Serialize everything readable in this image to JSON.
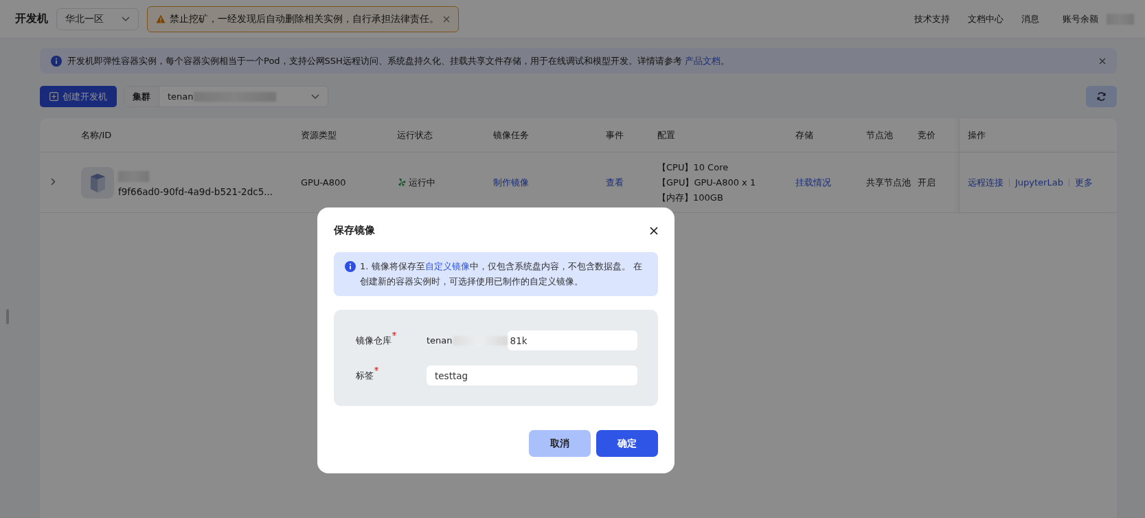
{
  "topbar": {
    "title": "开发机",
    "region": "华北一区",
    "warning": "禁止挖矿，一经发现后自动删除相关实例，自行承担法律责任。",
    "links": [
      "技术支持",
      "文档中心",
      "消息"
    ],
    "account_label": "账号余额"
  },
  "notice": {
    "text": "开发机即弹性容器实例，每个容器实例相当于一个Pod，支持公网SSH远程访问、系统盘持久化、挂载共享文件存储，用于在线调试和模型开发。详情请参考 ",
    "link": "产品文档",
    "end": "。"
  },
  "toolbar": {
    "create_button": "创建开发机",
    "cluster_label": "集群",
    "cluster_value": "tenan"
  },
  "table": {
    "columns": [
      "名称/ID",
      "资源类型",
      "运行状态",
      "镜像任务",
      "事件",
      "配置",
      "存储",
      "节点池",
      "竞价",
      "操作"
    ],
    "rows": [
      {
        "id": "f9f66ad0-90fd-4a9d-b521-2dc5...",
        "resource": "GPU-A800",
        "status": "运行中",
        "image_task": "制作镜像",
        "event": "查看",
        "config": [
          "【CPU】10 Core",
          "【GPU】GPU-A800 x 1",
          "【内存】100GB"
        ],
        "storage": "挂载情况",
        "pool": "共享节点池",
        "bid": "开启",
        "actions": [
          "远程连接",
          "JupyterLab",
          "更多"
        ]
      }
    ]
  },
  "dialog": {
    "title": "保存镜像",
    "info_start": "1. 镜像将保存至",
    "info_link": "自定义镜像",
    "info_end": "中，仅包含系统盘内容，不包含数据盘。 在创建新的容器实例时，可选择使用已制作的自定义镜像。",
    "fields": [
      {
        "label": "镜像仓库",
        "required": true,
        "value_start": "tenan",
        "value_end": "81k"
      },
      {
        "label": "标签",
        "required": true,
        "value": "testtag"
      }
    ],
    "buttons": [
      {
        "label": "取消",
        "kind": "secondary"
      },
      {
        "label": "确定",
        "kind": "primary"
      }
    ]
  }
}
